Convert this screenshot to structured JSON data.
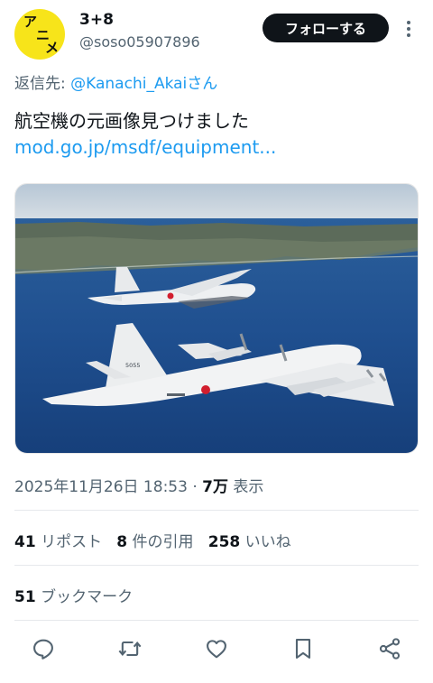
{
  "author": {
    "display_name": "3+8",
    "handle": "@soso05907896",
    "avatar_chars": [
      "ア",
      "ニ",
      "メ"
    ]
  },
  "header": {
    "follow_label": "フォローする"
  },
  "reply": {
    "prefix": "返信先:",
    "mention": "@Kanachi_Akai",
    "suffix": "さん"
  },
  "tweet": {
    "text": "航空機の元画像見つけました",
    "link_text": "mod.go.jp/msdf/equipment..."
  },
  "meta": {
    "timestamp": "2025年11月26日 18:53",
    "separator": "·",
    "views_count": "7万",
    "views_label": "表示"
  },
  "stats": {
    "reposts_count": "41",
    "reposts_label": "リポスト",
    "quotes_count": "8",
    "quotes_label": "件の引用",
    "likes_count": "258",
    "likes_label": "いいね",
    "bookmarks_count": "51",
    "bookmarks_label": "ブックマーク"
  },
  "media": {
    "tail_number": "5055"
  },
  "colors": {
    "accent": "#1d9bf0",
    "text": "#0f1419",
    "secondary": "#536471",
    "avatar_bg": "#f7e41a"
  },
  "icons": [
    "more-vertical-icon",
    "reply-icon",
    "repost-icon",
    "like-icon",
    "bookmark-icon",
    "share-icon"
  ]
}
